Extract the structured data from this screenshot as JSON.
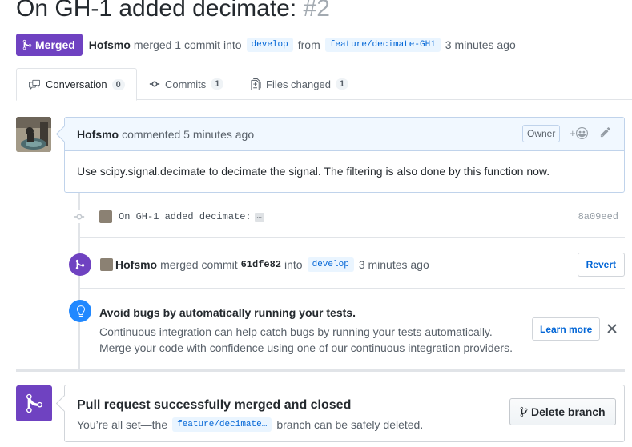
{
  "pr": {
    "title": "On GH-1 added decimate:",
    "number": "#2",
    "state_badge": "Merged",
    "author": "Hofsmo",
    "merge_text": "merged 1 commit into",
    "base_branch": "develop",
    "from_text": "from",
    "head_branch": "feature/decimate-GH1",
    "time": "3 minutes ago"
  },
  "tabs": [
    {
      "label": "Conversation",
      "count": "0"
    },
    {
      "label": "Commits",
      "count": "1"
    },
    {
      "label": "Files changed",
      "count": "1"
    }
  ],
  "comment": {
    "author": "Hofsmo",
    "action": "commented 5 minutes ago",
    "role": "Owner",
    "reaction_symbol": "+",
    "body": "Use scipy.signal.decimate to decimate the signal. The filtering is also done by this function now."
  },
  "commit": {
    "message": "On GH-1 added decimate:",
    "ellipsis": "…",
    "sha": "8a09eed"
  },
  "merge_event": {
    "author": "Hofsmo",
    "text": "merged commit",
    "sha": "61dfe82",
    "into": "into",
    "branch": "develop",
    "time": "3 minutes ago",
    "revert_label": "Revert"
  },
  "tip": {
    "title": "Avoid bugs by automatically running your tests.",
    "line1": "Continuous integration can help catch bugs by running your tests automatically.",
    "line2": "Merge your code with confidence using one of our continuous integration providers.",
    "learn_more": "Learn more"
  },
  "merged_box": {
    "title": "Pull request successfully merged and closed",
    "desc_before": "You’re all set—the",
    "branch": "feature/decimate…",
    "desc_after": "branch can be safely deleted.",
    "delete_label": "Delete branch"
  },
  "colors": {
    "merged_purple": "#6f42c1",
    "link_blue": "#0366d6",
    "tip_blue": "#2188ff"
  }
}
